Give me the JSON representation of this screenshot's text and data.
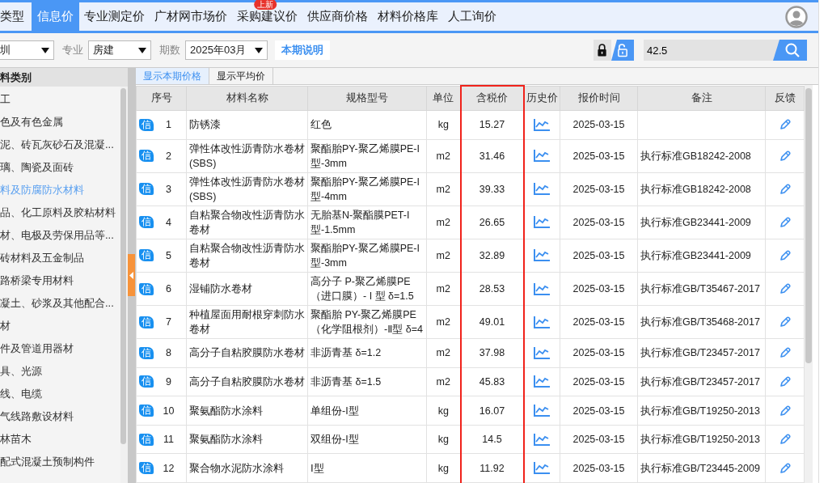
{
  "nav_tabs": [
    {
      "label": "类型",
      "selected": false
    },
    {
      "label": "信息价",
      "selected": true
    },
    {
      "label": "专业测定价",
      "selected": false
    },
    {
      "label": "广材网市场价",
      "selected": false
    },
    {
      "label": "采购建议价",
      "selected": false,
      "badge": "上新"
    },
    {
      "label": "供应商价格",
      "selected": false
    },
    {
      "label": "材料价格库",
      "selected": false
    },
    {
      "label": "人工询价",
      "selected": false
    }
  ],
  "filters": {
    "region": {
      "value": "圳"
    },
    "specialty": {
      "label": "专业",
      "value": "房建"
    },
    "period": {
      "label": "期数",
      "value": "2025年03月"
    },
    "info_button": "本期说明"
  },
  "lock_toggle": [
    {
      "kind": "locked",
      "selected": false
    },
    {
      "kind": "unlocked",
      "selected": true
    }
  ],
  "search": {
    "value": "42.5"
  },
  "sidebar": {
    "title": "料类别",
    "items": [
      {
        "label": "工",
        "selected": false
      },
      {
        "label": "色及有色金属",
        "selected": false
      },
      {
        "label": "泥、砖瓦灰砂石及混凝...",
        "selected": false
      },
      {
        "label": "璃、陶瓷及面砖",
        "selected": false
      },
      {
        "label": "料及防腐防水材料",
        "selected": true
      },
      {
        "label": "品、化工原料及胶粘材料",
        "selected": false
      },
      {
        "label": "材、电极及劳保用品等...",
        "selected": false
      },
      {
        "label": "砖材料及五金制品",
        "selected": false
      },
      {
        "label": "路桥梁专用材料",
        "selected": false
      },
      {
        "label": "凝土、砂浆及其他配合...",
        "selected": false
      },
      {
        "label": "材",
        "selected": false
      },
      {
        "label": "件及管道用器材",
        "selected": false
      },
      {
        "label": "具、光源",
        "selected": false
      },
      {
        "label": "线、电缆",
        "selected": false
      },
      {
        "label": "气线路敷设材料",
        "selected": false
      },
      {
        "label": "林苗木",
        "selected": false
      },
      {
        "label": "配式混凝土预制构件",
        "selected": false
      }
    ]
  },
  "view_tabs": [
    {
      "label": "显示本期价格",
      "selected": true
    },
    {
      "label": "显示平均价",
      "selected": false
    }
  ],
  "table": {
    "columns": [
      {
        "label": "序号",
        "highlighted": false
      },
      {
        "label": "材料名称",
        "highlighted": false
      },
      {
        "label": "规格型号",
        "highlighted": false
      },
      {
        "label": "单位",
        "highlighted": false
      },
      {
        "label": "含税价",
        "highlighted": true
      },
      {
        "label": "历史价",
        "highlighted": false
      },
      {
        "label": "报价时间",
        "highlighted": false
      },
      {
        "label": "备注",
        "highlighted": false
      },
      {
        "label": "反馈",
        "highlighted": false
      }
    ],
    "rows": [
      {
        "badge": "信",
        "no": "1",
        "name": "防锈漆",
        "spec": "红色",
        "unit": "kg",
        "price": "15.27",
        "date": "2025-03-15"
      },
      {
        "badge": "信",
        "no": "2",
        "name": "弹性体改性沥青防水卷材(SBS)",
        "spec": "聚酯胎PY-聚乙烯膜PE-I型-3mm",
        "unit": "m2",
        "price": "31.46",
        "date": "2025-03-15",
        "note": "执行标准GB18242-2008"
      },
      {
        "badge": "信",
        "no": "3",
        "name": "弹性体改性沥青防水卷材(SBS)",
        "spec": "聚酯胎PY-聚乙烯膜PE-I型-4mm",
        "unit": "m2",
        "price": "39.33",
        "date": "2025-03-15",
        "note": "执行标准GB18242-2008"
      },
      {
        "badge": "信",
        "no": "4",
        "name": "自粘聚合物改性沥青防水卷材",
        "spec": "无胎基N-聚酯膜PET-I型-1.5mm",
        "unit": "m2",
        "price": "26.65",
        "date": "2025-03-15",
        "note": "执行标准GB23441-2009"
      },
      {
        "badge": "信",
        "no": "5",
        "name": "自粘聚合物改性沥青防水卷材",
        "spec": "聚酯胎PY-聚乙烯膜PE-I型-3mm",
        "unit": "m2",
        "price": "32.89",
        "date": "2025-03-15",
        "note": "执行标准GB23441-2009"
      },
      {
        "badge": "信",
        "no": "6",
        "name": "湿铺防水卷材",
        "spec": "高分子 P-聚乙烯膜PE（进口膜）- I 型 δ=1.5",
        "unit": "m2",
        "price": "28.53",
        "date": "2025-03-15",
        "note": "执行标准GB/T35467-2017"
      },
      {
        "badge": "信",
        "no": "7",
        "name": "种植屋面用耐根穿刺防水卷材",
        "spec": "聚酯胎 PY-聚乙烯膜PE（化学阻根剂）-Ⅱ型 δ=4",
        "unit": "m2",
        "price": "49.01",
        "date": "2025-03-15",
        "note": "执行标准GB/T35468-2017"
      },
      {
        "badge": "信",
        "no": "8",
        "name": "高分子自粘胶膜防水卷材",
        "spec": "非沥青基 δ=1.2",
        "unit": "m2",
        "price": "37.98",
        "date": "2025-03-15",
        "note": "执行标准GB/T23457-2017"
      },
      {
        "badge": "信",
        "no": "9",
        "name": "高分子自粘胶膜防水卷材",
        "spec": "非沥青基 δ=1.5",
        "unit": "m2",
        "price": "45.83",
        "date": "2025-03-15",
        "note": "执行标准GB/T23457-2017"
      },
      {
        "badge": "信",
        "no": "10",
        "name": "聚氨酯防水涂料",
        "spec": "单组份-I型",
        "unit": "kg",
        "price": "16.07",
        "date": "2025-03-15",
        "note": "执行标准GB/T19250-2013"
      },
      {
        "badge": "信",
        "no": "11",
        "name": "聚氨酯防水涂料",
        "spec": "双组份-I型",
        "unit": "kg",
        "price": "14.5",
        "date": "2025-03-15",
        "note": "执行标准GB/T19250-2013"
      },
      {
        "badge": "信",
        "no": "12",
        "name": "聚合物水泥防水涂料",
        "spec": "Ⅰ型",
        "unit": "kg",
        "price": "11.92",
        "date": "2025-03-15",
        "note": "执行标准GB/T23445-2009"
      }
    ]
  }
}
